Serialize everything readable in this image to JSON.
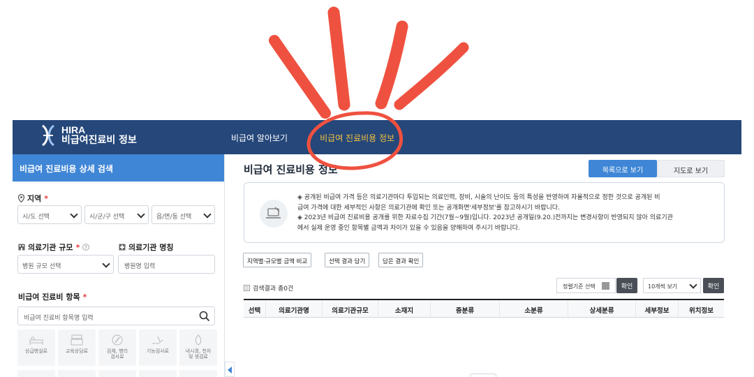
{
  "header": {
    "logo_hira": "HIRA",
    "logo_name": "비급여진료비 정보",
    "nav": [
      "비급여 알아보기",
      "비급여 진료비용 정보"
    ]
  },
  "sidebar": {
    "title": "비급여 진료비용 상세 검색",
    "region_label": "지역",
    "region_selects": [
      "시/도 선택",
      "시/군/구 선택",
      "읍/면/동 선택"
    ],
    "size_label": "의료기관 규모",
    "size_select": "병원 규모 선택",
    "name_label": "의료기관 명칭",
    "name_placeholder": "병원명 입력",
    "item_label": "비급여 진료비 항목",
    "item_placeholder": "비급여 진료비 항목명 입력",
    "categories": [
      "상급병실료",
      "교육상담료",
      "검체, 병리\n검사료",
      "기능검사료",
      "내시경, 천자\n및 생검료"
    ]
  },
  "main": {
    "title": "비급여 진료비용 정보",
    "view_list": "목록으로 보기",
    "view_map": "지도로 보기",
    "notice_lines": [
      "◈ 공개된 비급여 가격 등은 의료기관마다 투입되는 의료인력, 장비, 시술의 난이도 등의 특성을 반영하여 자율적으로 정한 것으로 공개된 비",
      "급여 가격에 대한 세부적인 사항은 의료기관에 확인 또는 공개화면'세부정보'를 참고하시기 바랍니다.",
      "◈ 2023년 비급여 진료비용 공개를 위한 자료수집 기간(7월~9월)입니다. 2023년 공개일(9.20.)전까지는 변경사항이 반영되지 않아 의료기관",
      "에서 실제 운영 중인 항목별 금액과 차이가 있을 수 있음을 양해하여 주시기 바랍니다."
    ],
    "tools": [
      "지역별·규모별 금액 비교",
      "선택 결과 담기",
      "담은 결과 확인"
    ],
    "result_count": "검색결과 총0건",
    "sort_label": "정렬기준 선택",
    "ok_label": "확인",
    "per_page": "10개씩 보기",
    "columns": [
      "선택",
      "의료기관명",
      "의료기관규모",
      "소재지",
      "중분류",
      "소분류",
      "상세분류",
      "세부정보",
      "위치정보"
    ]
  },
  "colors": {
    "header_bg": "#25477a",
    "accent_blue": "#3f86d6",
    "nav_active": "#f5c23a",
    "annotation_red": "#ef5140"
  }
}
